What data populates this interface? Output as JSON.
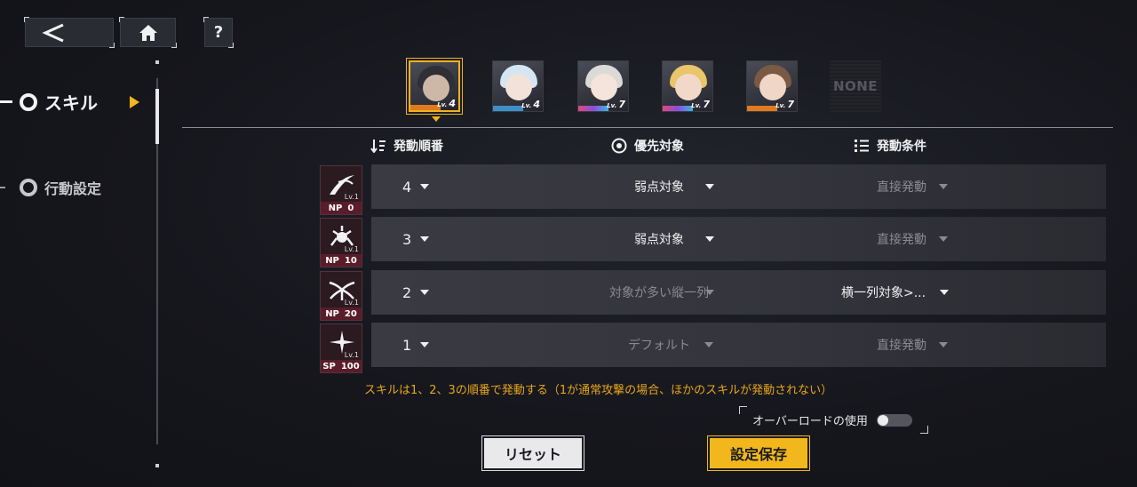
{
  "top": {
    "help_label": "?"
  },
  "sidebar": {
    "items": [
      {
        "label": "スキル",
        "active": true
      },
      {
        "label": "行動設定",
        "active": false
      }
    ]
  },
  "characters": [
    {
      "level_prefix": "Lv.",
      "level": "4",
      "selected": true
    },
    {
      "level_prefix": "Lv.",
      "level": "4"
    },
    {
      "level_prefix": "Lv.",
      "level": "7"
    },
    {
      "level_prefix": "Lv.",
      "level": "7"
    },
    {
      "level_prefix": "Lv.",
      "level": "7"
    },
    {
      "label": "NONE",
      "empty": true
    }
  ],
  "headers": {
    "order": "発動順番",
    "target": "優先対象",
    "condition": "発動条件"
  },
  "skills": [
    {
      "cost_type": "NP",
      "cost": "0",
      "lv": "Lv.1",
      "order": "4",
      "target": "弱点対象",
      "condition": "直接発動"
    },
    {
      "cost_type": "NP",
      "cost": "10",
      "lv": "Lv.1",
      "order": "3",
      "target": "弱点対象",
      "condition": "直接発動"
    },
    {
      "cost_type": "NP",
      "cost": "20",
      "lv": "Lv.1",
      "order": "2",
      "target": "対象が多い縦一列",
      "condition": "横一列対象>..."
    },
    {
      "cost_type": "SP",
      "cost": "100",
      "lv": "Lv.1",
      "order": "1",
      "target": "デフォルト",
      "condition": "直接発動"
    }
  ],
  "note": "スキルは1、2、3の順番で発動する（1が通常攻撃の場合、ほかのスキルが発動されない）",
  "overload": {
    "label": "オーバーロードの使用",
    "enabled": false
  },
  "buttons": {
    "reset": "リセット",
    "save": "設定保存"
  },
  "colors": {
    "accent": "#f2b71d",
    "note": "#e8a51c"
  }
}
